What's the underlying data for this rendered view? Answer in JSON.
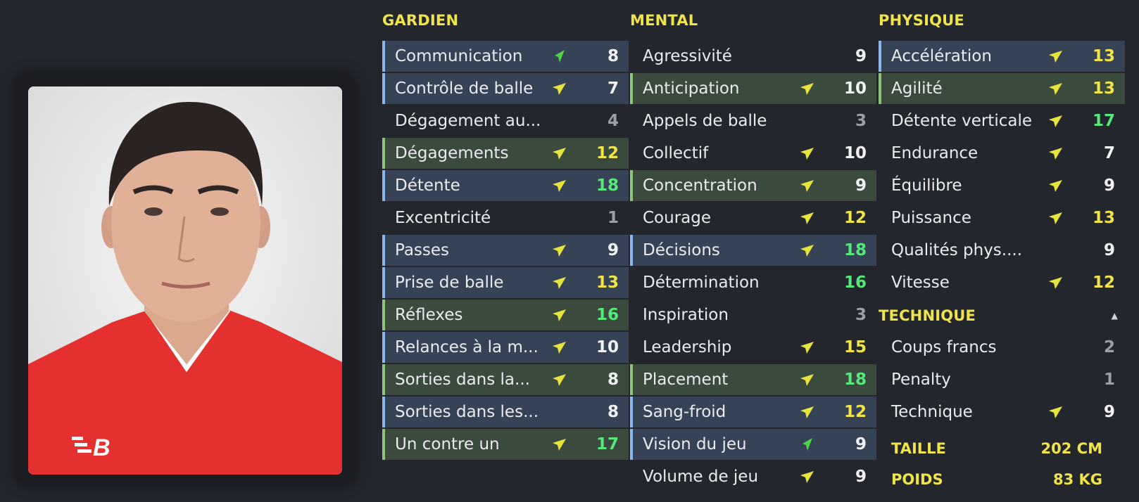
{
  "colors": {
    "background": "#23262d",
    "accent_yellow": "#f0e44a",
    "value_green": "#57e879",
    "row_blue": "#364357",
    "row_green": "#3a4a3d",
    "arrow_yellow": "#e7e43c",
    "arrow_green": "#4fd44a"
  },
  "photo": {
    "icon": "player-photo",
    "brand_logo": "new-balance-logo"
  },
  "gardien": {
    "title": "GARDIEN",
    "rows": [
      {
        "label": "Communication",
        "value": "8",
        "arrow": "green",
        "highlight": "blue",
        "value_color": "white"
      },
      {
        "label": "Contrôle de balle",
        "value": "7",
        "arrow": "yellow",
        "highlight": "blue",
        "value_color": "white"
      },
      {
        "label": "Dégagement au...",
        "value": "4",
        "arrow": "none",
        "highlight": "none",
        "value_color": "grey"
      },
      {
        "label": "Dégagements",
        "value": "12",
        "arrow": "yellow",
        "highlight": "green",
        "value_color": "yellow"
      },
      {
        "label": "Détente",
        "value": "18",
        "arrow": "yellow",
        "highlight": "blue",
        "value_color": "green"
      },
      {
        "label": "Excentricité",
        "value": "1",
        "arrow": "none",
        "highlight": "none",
        "value_color": "grey"
      },
      {
        "label": "Passes",
        "value": "9",
        "arrow": "yellow",
        "highlight": "blue",
        "value_color": "white"
      },
      {
        "label": "Prise de balle",
        "value": "13",
        "arrow": "yellow",
        "highlight": "blue",
        "value_color": "yellow"
      },
      {
        "label": "Réflexes",
        "value": "16",
        "arrow": "yellow",
        "highlight": "green",
        "value_color": "green"
      },
      {
        "label": "Relances à la m...",
        "value": "10",
        "arrow": "yellow",
        "highlight": "blue",
        "value_color": "white"
      },
      {
        "label": "Sorties dans la...",
        "value": "8",
        "arrow": "yellow",
        "highlight": "green",
        "value_color": "white"
      },
      {
        "label": "Sorties dans les...",
        "value": "8",
        "arrow": "none",
        "highlight": "blue",
        "value_color": "white"
      },
      {
        "label": "Un contre un",
        "value": "17",
        "arrow": "yellow",
        "highlight": "green",
        "value_color": "green"
      }
    ]
  },
  "mental": {
    "title": "MENTAL",
    "rows": [
      {
        "label": "Agressivité",
        "value": "9",
        "arrow": "none",
        "highlight": "none",
        "value_color": "white"
      },
      {
        "label": "Anticipation",
        "value": "10",
        "arrow": "yellow",
        "highlight": "green",
        "value_color": "white"
      },
      {
        "label": "Appels de balle",
        "value": "3",
        "arrow": "none",
        "highlight": "none",
        "value_color": "grey"
      },
      {
        "label": "Collectif",
        "value": "10",
        "arrow": "yellow",
        "highlight": "none",
        "value_color": "white"
      },
      {
        "label": "Concentration",
        "value": "9",
        "arrow": "yellow",
        "highlight": "green",
        "value_color": "white"
      },
      {
        "label": "Courage",
        "value": "12",
        "arrow": "yellow",
        "highlight": "none",
        "value_color": "yellow"
      },
      {
        "label": "Décisions",
        "value": "18",
        "arrow": "yellow",
        "highlight": "blue",
        "value_color": "green"
      },
      {
        "label": "Détermination",
        "value": "16",
        "arrow": "none",
        "highlight": "none",
        "value_color": "green"
      },
      {
        "label": "Inspiration",
        "value": "3",
        "arrow": "none",
        "highlight": "none",
        "value_color": "grey"
      },
      {
        "label": "Leadership",
        "value": "15",
        "arrow": "yellow",
        "highlight": "none",
        "value_color": "yellow"
      },
      {
        "label": "Placement",
        "value": "18",
        "arrow": "yellow",
        "highlight": "green",
        "value_color": "green"
      },
      {
        "label": "Sang-froid",
        "value": "12",
        "arrow": "yellow",
        "highlight": "blue",
        "value_color": "yellow"
      },
      {
        "label": "Vision du jeu",
        "value": "9",
        "arrow": "green",
        "highlight": "blue",
        "value_color": "white"
      },
      {
        "label": "Volume de jeu",
        "value": "9",
        "arrow": "yellow",
        "highlight": "none",
        "value_color": "white"
      }
    ]
  },
  "physique": {
    "title": "PHYSIQUE",
    "rows": [
      {
        "label": "Accélération",
        "value": "13",
        "arrow": "yellow",
        "highlight": "blue",
        "value_color": "yellow"
      },
      {
        "label": "Agilité",
        "value": "13",
        "arrow": "yellow",
        "highlight": "green",
        "value_color": "yellow"
      },
      {
        "label": "Détente verticale",
        "value": "17",
        "arrow": "yellow",
        "highlight": "none",
        "value_color": "green"
      },
      {
        "label": "Endurance",
        "value": "7",
        "arrow": "yellow",
        "highlight": "none",
        "value_color": "white"
      },
      {
        "label": "Équilibre",
        "value": "9",
        "arrow": "yellow",
        "highlight": "none",
        "value_color": "white"
      },
      {
        "label": "Puissance",
        "value": "13",
        "arrow": "yellow",
        "highlight": "none",
        "value_color": "yellow"
      },
      {
        "label": "Qualités phys....",
        "value": "9",
        "arrow": "none",
        "highlight": "none",
        "value_color": "white"
      },
      {
        "label": "Vitesse",
        "value": "12",
        "arrow": "yellow",
        "highlight": "none",
        "value_color": "yellow"
      }
    ]
  },
  "technique": {
    "title": "TECHNIQUE",
    "collapse_icon": "▲",
    "rows": [
      {
        "label": "Coups francs",
        "value": "2",
        "arrow": "none",
        "highlight": "none",
        "value_color": "grey"
      },
      {
        "label": "Penalty",
        "value": "1",
        "arrow": "none",
        "highlight": "none",
        "value_color": "grey"
      },
      {
        "label": "Technique",
        "value": "9",
        "arrow": "yellow",
        "highlight": "none",
        "value_color": "white"
      }
    ]
  },
  "measures": {
    "height_label": "TAILLE",
    "height_value": "202 CM",
    "weight_label": "POIDS",
    "weight_value": "83 KG"
  }
}
